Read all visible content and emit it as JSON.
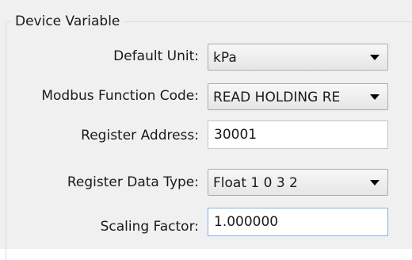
{
  "group": {
    "title": "Device  Variable"
  },
  "fields": {
    "default_unit": {
      "label": "Default Unit:",
      "value": "kPa"
    },
    "modbus_function_code": {
      "label": "Modbus Function Code:",
      "value": "READ HOLDING RE"
    },
    "register_address": {
      "label": "Register Address:",
      "value": "30001"
    },
    "register_data_type": {
      "label": "Register Data Type:",
      "value": "Float 1 0 3 2"
    },
    "scaling_factor": {
      "label": "Scaling Factor:",
      "value": "1.000000"
    }
  },
  "icons": {
    "dropdown": "chevron-down-icon"
  }
}
